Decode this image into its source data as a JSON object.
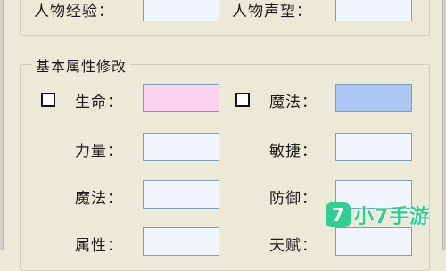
{
  "top_row": {
    "experience_label": "人物经验：",
    "experience_value": "",
    "reputation_label": "人物声望：",
    "reputation_value": ""
  },
  "basic_attributes": {
    "title": "基本属性修改",
    "hp_label": "生命：",
    "hp_value": "",
    "hp_field_color": "#fcd3ef",
    "mp_label": "魔法：",
    "mp_value": "",
    "mp_field_color": "#adc8f4",
    "strength_label": "力量：",
    "strength_value": "",
    "agility_label": "敏捷：",
    "agility_value": "",
    "magic_label": "魔法：",
    "magic_value": "",
    "defense_label": "防御：",
    "defense_value": "",
    "attribute_label": "属性：",
    "attribute_value": "",
    "talent_label": "天赋：",
    "talent_value": ""
  },
  "watermark": {
    "logo_text": "7",
    "text": "小7手游",
    "color": "#2fcf8f"
  }
}
